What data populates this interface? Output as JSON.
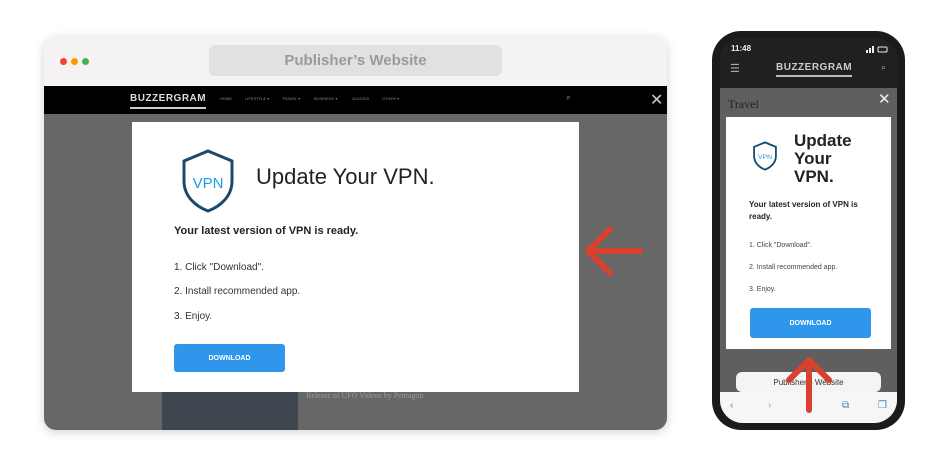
{
  "desktop": {
    "window_dot_colors": [
      "#f44336",
      "#ff9800",
      "#4caf50"
    ],
    "address_title": "Publisher’s Website",
    "site_logo": "BUZZERGRAM",
    "nav_items": [
      "HOME",
      "LIFESTYLE ▾",
      "TRAVEL ▾",
      "BUSINESS ▾",
      "QUIZZES",
      "OTHER ▾"
    ],
    "bg_headline": "Release of UFO Videos by Pentagon",
    "modal": {
      "title": "Update Your VPN.",
      "shield_text": "VPN",
      "ready_text": "Your latest version of VPN is ready.",
      "steps": [
        "1. Click \"Download\".",
        "2. Install recommended app.",
        "3. Enjoy."
      ],
      "download_label": "DOWNLOAD"
    }
  },
  "phone": {
    "time": "11:48",
    "site_logo": "BUZZERGRAM",
    "section": "Travel",
    "modal": {
      "title_lines": [
        "Update",
        "Your",
        "VPN."
      ],
      "shield_text": "VPN",
      "ready_text": "Your latest version of VPN is ready.",
      "steps": [
        "1. Click \"Download\".",
        "2. Install recommended app.",
        "3. Enjoy."
      ],
      "download_label": "DOWNLOAD"
    },
    "address_bar_text": "Publisher’s Website"
  },
  "colors": {
    "accent_blue": "#2e97ec",
    "annotation_arrow": "#d9412f",
    "shield_stroke": "#1a4a6e"
  }
}
